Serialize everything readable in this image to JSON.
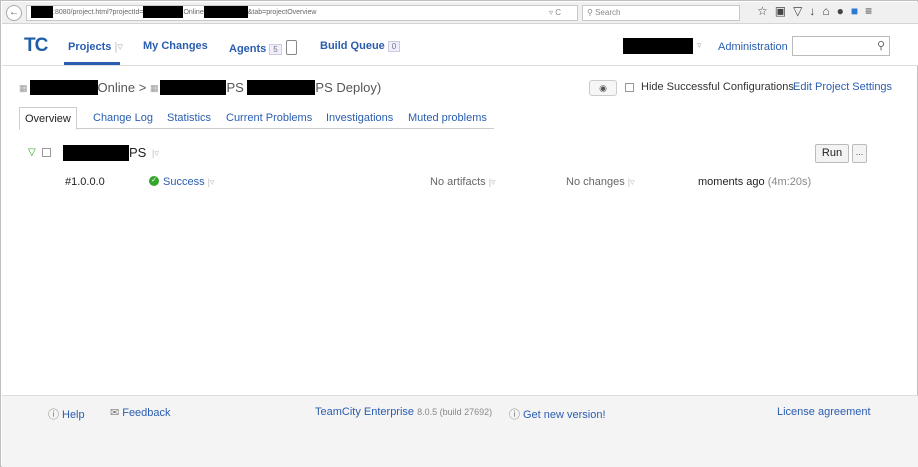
{
  "browser": {
    "back_icon": "back-arrow-icon",
    "url_parts": [
      ":8080/project.html?projectId=",
      "Online",
      "&tab=projectOverview"
    ],
    "reload_glyph": "▿ C",
    "search_placeholder": "Search"
  },
  "header": {
    "logo": "TC",
    "nav": {
      "projects": "Projects",
      "my_changes": "My Changes",
      "agents": "Agents",
      "agents_count": "5",
      "build_queue": "Build Queue",
      "build_queue_count": "0"
    },
    "administration": "Administration"
  },
  "breadcrumb": {
    "project_suffix": "Online",
    "separator": ">",
    "sub_mid": "PS",
    "sub_suffix": "PS Deploy)"
  },
  "actions": {
    "hide_successful": "Hide Successful Configurations",
    "edit_settings": "Edit Project Settings"
  },
  "tabs": [
    {
      "label": "Overview",
      "active": true
    },
    {
      "label": "Change Log"
    },
    {
      "label": "Statistics"
    },
    {
      "label": "Current Problems"
    },
    {
      "label": "Investigations"
    },
    {
      "label": "Muted problems"
    }
  ],
  "build_config": {
    "name_suffix": "PS",
    "run_label": "Run",
    "more_label": "..."
  },
  "build": {
    "number": "#1.0.0.0",
    "status": "Success",
    "artifacts": "No artifacts",
    "changes": "No changes",
    "finished": "moments ago",
    "duration": "(4m:20s)"
  },
  "footer": {
    "help": "Help",
    "feedback": "Feedback",
    "product": "TeamCity Enterprise",
    "version": "8.0.5 (build 27692)",
    "new_version": "Get new version!",
    "license": "License agreement"
  },
  "colors": {
    "link": "#2a5db0",
    "success": "#36a52c",
    "logo": "#1e5ea8"
  }
}
